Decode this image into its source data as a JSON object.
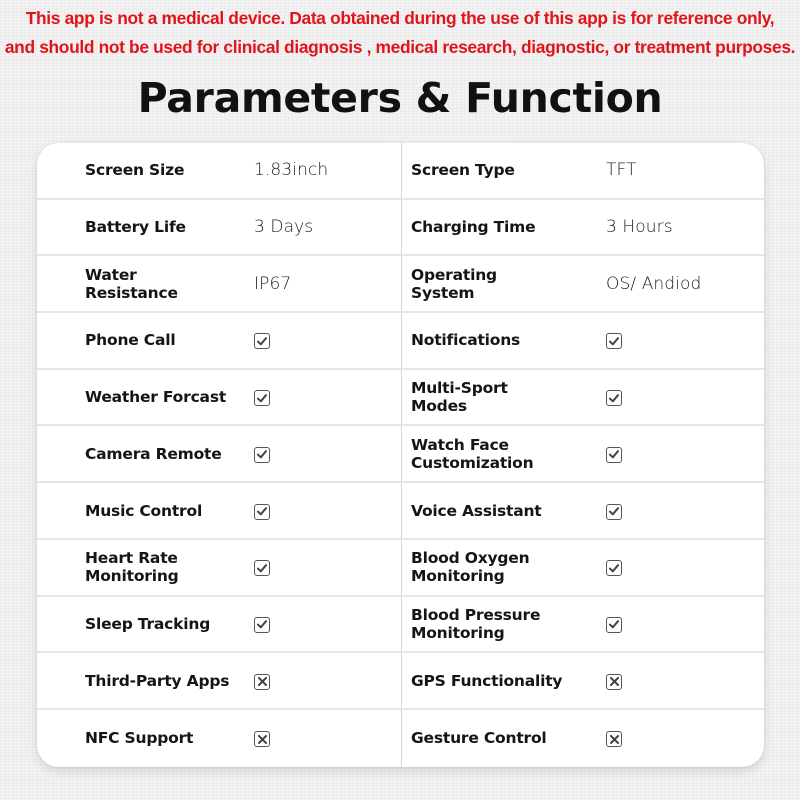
{
  "disclaimer": {
    "line1": "This app is not a medical device. Data obtained during the use of this app is for reference only,",
    "line2": "and should not be used for clinical diagnosis , medical research, diagnostic, or treatment purposes.",
    "color": "#e0141b"
  },
  "title": "Parameters & Function",
  "specs": [
    {
      "left_label": "Screen Size",
      "left_value": "1.83inch",
      "right_label": "Screen Type",
      "right_value": "TFT"
    },
    {
      "left_label": "Battery Life",
      "left_value": "3 Days",
      "right_label": "Charging Time",
      "right_value": "3 Hours"
    },
    {
      "left_label": "Water Resistance",
      "left_value": "IP67",
      "right_label": "Operating System",
      "right_value": "OS/ Andiod"
    },
    {
      "left_label": "Phone Call",
      "left_value": "check",
      "right_label": "Notifications",
      "right_value": "check"
    },
    {
      "left_label": "Weather Forcast",
      "left_value": "check",
      "right_label": "Multi-Sport Modes",
      "right_value": "check"
    },
    {
      "left_label": "Camera Remote",
      "left_value": "check",
      "right_label": "Watch Face Customization",
      "right_value": "check"
    },
    {
      "left_label": "Music Control",
      "left_value": "check",
      "right_label": "Voice Assistant",
      "right_value": "check"
    },
    {
      "left_label": "Heart Rate Monitoring",
      "left_value": "check",
      "right_label": "Blood Oxygen Monitoring",
      "right_value": "check"
    },
    {
      "left_label": "Sleep Tracking",
      "left_value": "check",
      "right_label": "Blood Pressure Monitoring",
      "right_value": "check"
    },
    {
      "left_label": "Third-Party Apps",
      "left_value": "cross",
      "right_label": "GPS Functionality",
      "right_value": "cross"
    },
    {
      "left_label": "NFC Support",
      "left_value": "cross",
      "right_label": "Gesture Control",
      "right_value": "cross"
    }
  ],
  "row_labels_wrapped": {
    "Water Resistance": [
      "Water",
      "Resistance"
    ],
    "Operating System": [
      "Operating",
      "System"
    ],
    "Multi-Sport Modes": [
      "Multi-Sport",
      "Modes"
    ],
    "Watch Face Customization": [
      "Watch Face",
      "Customization"
    ],
    "Heart Rate Monitoring": [
      "Heart Rate",
      "Monitoring"
    ],
    "Blood Oxygen Monitoring": [
      "Blood Oxygen",
      "Monitoring"
    ],
    "Blood Pressure Monitoring": [
      "Blood Pressure",
      "Monitoring"
    ]
  },
  "icons": {
    "check": "checked-box-icon",
    "cross": "crossed-box-icon"
  }
}
